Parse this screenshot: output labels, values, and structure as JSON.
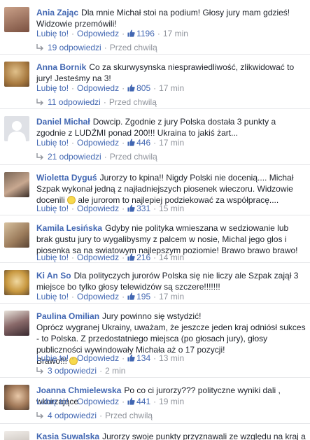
{
  "actions": {
    "like": "Lubię to!",
    "reply": "Odpowiedz"
  },
  "comments": [
    {
      "author": "Ania Zając",
      "text": "Dla mnie Michał stoi na podium! Głosy jury mam gdzieś! Widzowie przemówili!",
      "likes": "1196",
      "time": "17 min",
      "replies": "19 odpowiedzi",
      "replies_time": "Przed chwilą"
    },
    {
      "author": "Anna Bornik",
      "text": "Co za skurwysynska niesprawiedliwość, zlikwidować to jury! Jesteśmy na 3!",
      "likes": "805",
      "time": "17 min",
      "replies": "11 odpowiedzi",
      "replies_time": "Przed chwilą"
    },
    {
      "author": "Daniel Michał",
      "text": "Dowcip. Zgodnie z jury Polska dostała 3 punkty a zgodnie z LUDŹMI ponad 200!!! Ukraina to jakiś żart...",
      "likes": "446",
      "time": "17 min",
      "replies": "21 odpowiedzi",
      "replies_time": "Przed chwilą"
    },
    {
      "author": "Wioletta Dyguś",
      "text": "Jurorzy to kpina!! Nigdy Polski nie docenią.... Michał Szpak wykonał jedną z najładniejszych piosenek wieczoru. Widzowie docenili",
      "text_after": "ale jurorom to najlepiej podziekować za współpracę....",
      "likes": "331",
      "time": "15 min"
    },
    {
      "author": "Kamila Lesińska",
      "text": "Gdyby nie polityka wmieszana w sedziowanie lub brak gustu jury to wygalibysmy z palcem w nosie, Michal jego glos i piosenka sa na swiatowym najlepszym poziomie! Brawo brawo brawo!",
      "likes": "216",
      "time": "14 min"
    },
    {
      "author": "Ki An So",
      "text": "Dla polityczych jurorów Polska się nie liczy ale Szpak zajął 3 miejsce bo tylko głosy telewidzów są szczere!!!!!!!",
      "likes": "195",
      "time": "17 min"
    },
    {
      "author": "Paulina Omilian",
      "text_lines": [
        "Jury powinno się wstydzić!",
        "Oprócz wygranej Ukrainy, uważam, że jeszcze jeden kraj odniósł sukces - to Polska. Z przedostatniego miejsca (po głosach jury), głosy publiczności wywindowały Michała aż o 17 pozycji!",
        "Brawo!!!"
      ],
      "likes": "134",
      "time": "13 min",
      "replies": "3 odpowiedzi",
      "replies_time": "2 min"
    },
    {
      "author": "Joanna Chmielewska",
      "text": "Po co ci jurorzy??? polityczne wyniki dali , wkurzające",
      "likes": "441",
      "time": "19 min",
      "replies": "4 odpowiedzi",
      "replies_time": "Przed chwilą"
    },
    {
      "author": "Kasia Suwalska",
      "text": "Jurorzy swoje punkty przyznawali ze względu na kraj a nie na"
    }
  ]
}
